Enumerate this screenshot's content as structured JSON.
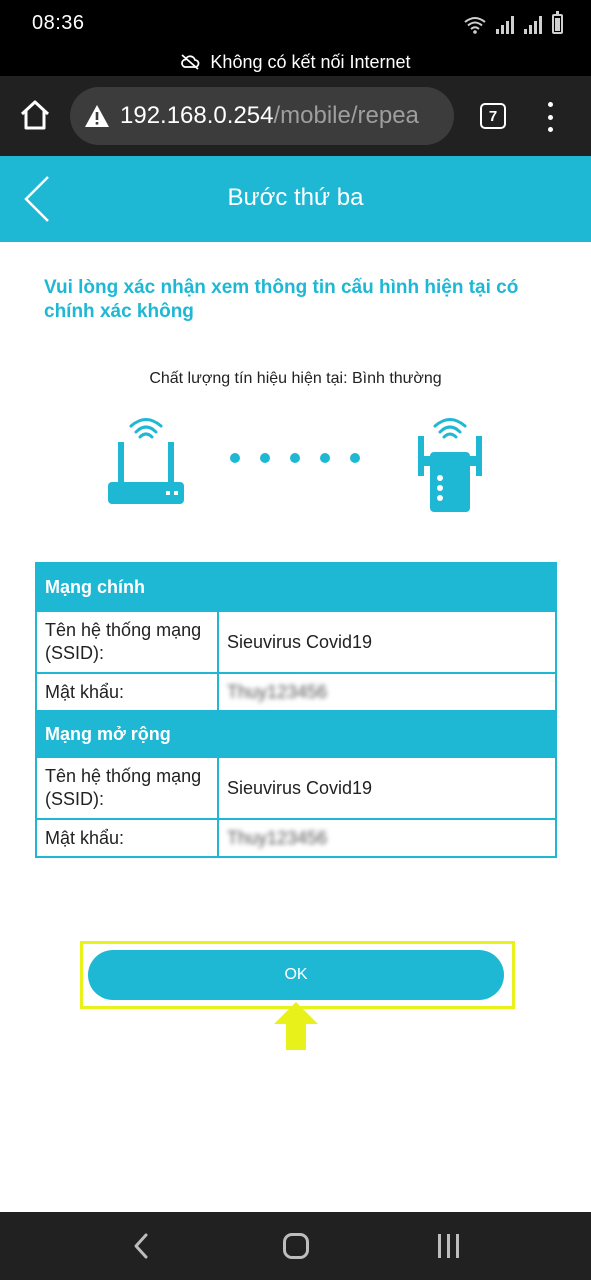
{
  "status_bar": {
    "time": "08:36"
  },
  "offline_banner": {
    "text": "Không có kết nối Internet"
  },
  "browser": {
    "url_host": "192.168.0.254",
    "url_path": "/mobile/repea",
    "tab_count": "7"
  },
  "header": {
    "title": "Bước thứ ba"
  },
  "instruction": "Vui lòng xác nhận xem thông tin cấu hình hiện tại có chính xác không",
  "signal_quality": "Chất lượng tín hiệu hiện tại: Bình thường",
  "main_network": {
    "heading": "Mạng chính",
    "ssid_label": "Tên hệ thống mạng (SSID):",
    "ssid_value": "Sieuvirus Covid19",
    "password_label": "Mật khẩu:",
    "password_value": "Thuy123456"
  },
  "extended_network": {
    "heading": "Mạng mở rộng",
    "ssid_label": "Tên hệ thống mạng (SSID):",
    "ssid_value": "Sieuvirus Covid19",
    "password_label": "Mật khẩu:",
    "password_value": "Thuy123456"
  },
  "ok_button": {
    "label": "OK"
  },
  "colors": {
    "accent": "#1fb8d4",
    "highlight": "#e8f21a",
    "toolbar": "#212121"
  },
  "icons": [
    "wifi-icon",
    "signal-icon",
    "battery-icon",
    "cloud-off-icon",
    "home-icon",
    "warning-icon",
    "tabs-icon",
    "more-vert-icon",
    "back-chevron-icon",
    "router-icon",
    "range-extender-icon",
    "arrow-up-icon",
    "nav-back-icon",
    "nav-home-icon",
    "nav-recents-icon"
  ]
}
